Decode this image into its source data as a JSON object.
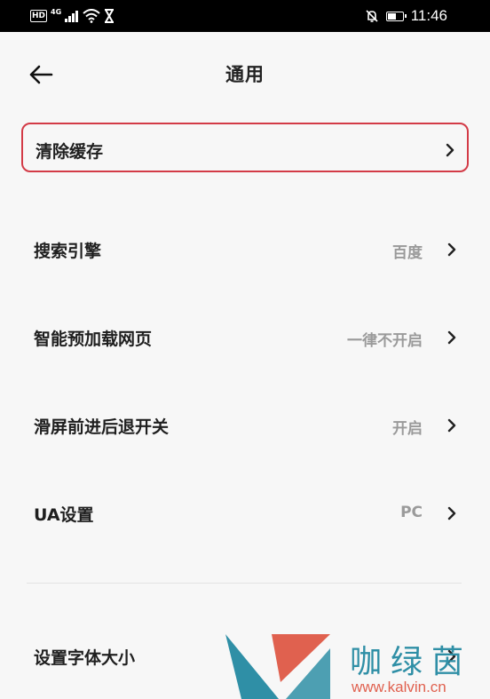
{
  "status_bar": {
    "hd": "HD",
    "network": "4G",
    "time": "11:46",
    "battery_level": 0.6
  },
  "header": {
    "title": "通用"
  },
  "settings": {
    "items": [
      {
        "label": "清除缓存",
        "value": ""
      },
      {
        "label": "搜索引擎",
        "value": "百度"
      },
      {
        "label": "智能预加载网页",
        "value": "一律不开启"
      },
      {
        "label": "滑屏前进后退开关",
        "value": "开启"
      },
      {
        "label": "UA设置",
        "value": "PC"
      },
      {
        "label": "设置字体大小",
        "value": ""
      }
    ]
  },
  "watermark": {
    "chars": "咖绿茵",
    "url": "www.kalvin.cn",
    "colors": {
      "teal": "#2f8fa6",
      "coral": "#e0614f"
    }
  },
  "colors": {
    "highlight": "#d33b47",
    "background": "#f7f7f7",
    "value_text": "#9a9a9a"
  }
}
